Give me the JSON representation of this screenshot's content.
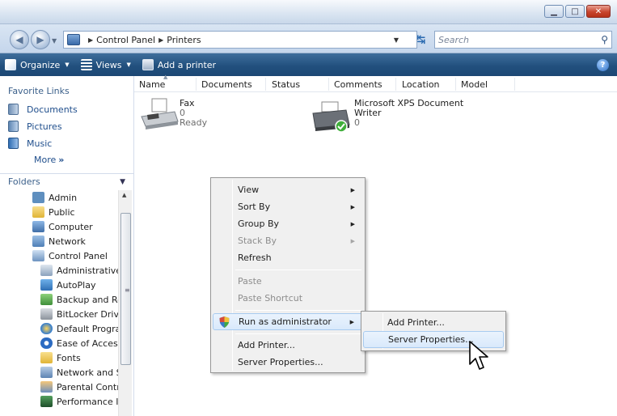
{
  "address": {
    "path": [
      "Control Panel",
      "Printers"
    ],
    "search_placeholder": "Search"
  },
  "toolbar": {
    "organize": "Organize",
    "views": "Views",
    "add_printer": "Add a printer"
  },
  "favorites": {
    "header": "Favorite Links",
    "items": [
      "Documents",
      "Pictures",
      "Music"
    ],
    "more": "More"
  },
  "folders": {
    "header": "Folders",
    "items": [
      "Admin",
      "Public",
      "Computer",
      "Network",
      "Control Panel",
      "Administrative",
      "AutoPlay",
      "Backup and Re",
      "BitLocker Drive",
      "Default Progra",
      "Ease of Access",
      "Fonts",
      "Network and S",
      "Parental Contr",
      "Performance Ir"
    ]
  },
  "columns": [
    "Name",
    "Documents",
    "Status",
    "Comments",
    "Location",
    "Model"
  ],
  "printers": [
    {
      "name": "Fax",
      "docs": "0",
      "status": "Ready"
    },
    {
      "name_line1": "Microsoft XPS Document",
      "name_line2": "Writer",
      "docs": "0"
    }
  ],
  "context_menu": {
    "view": "View",
    "sort_by": "Sort By",
    "group_by": "Group By",
    "stack_by": "Stack By",
    "refresh": "Refresh",
    "paste": "Paste",
    "paste_shortcut": "Paste Shortcut",
    "run_as_admin": "Run as administrator",
    "add_printer": "Add Printer...",
    "server_properties": "Server Properties..."
  },
  "submenu": {
    "add_printer": "Add Printer...",
    "server_properties": "Server Properties..."
  }
}
